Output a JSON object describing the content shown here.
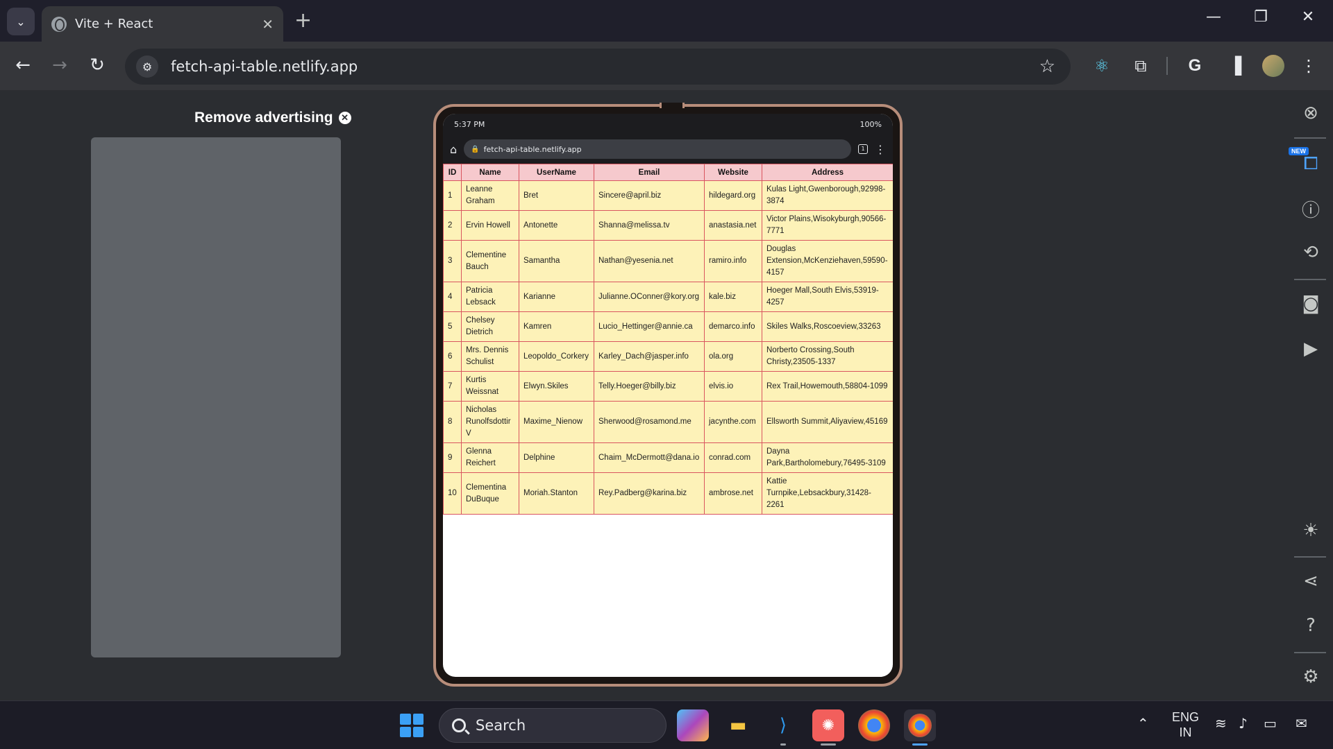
{
  "browser": {
    "tab_title": "Vite + React",
    "url": "fetch-api-table.netlify.app",
    "new_tab": "+",
    "close_tab": "✕"
  },
  "sidebar_ad": {
    "remove_label": "Remove advertising"
  },
  "device": {
    "status_time": "5:37 PM",
    "status_battery": "100%",
    "mobile_url": "fetch-api-table.netlify.app",
    "tab_count": "1"
  },
  "table": {
    "headers": [
      "ID",
      "Name",
      "UserName",
      "Email",
      "Website",
      "Address"
    ],
    "rows": [
      {
        "id": "1",
        "name": "Leanne Graham",
        "username": "Bret",
        "email": "Sincere@april.biz",
        "website": "hildegard.org",
        "address": "Kulas Light,Gwenborough,92998-3874"
      },
      {
        "id": "2",
        "name": "Ervin Howell",
        "username": "Antonette",
        "email": "Shanna@melissa.tv",
        "website": "anastasia.net",
        "address": "Victor Plains,Wisokyburgh,90566-7771"
      },
      {
        "id": "3",
        "name": "Clementine Bauch",
        "username": "Samantha",
        "email": "Nathan@yesenia.net",
        "website": "ramiro.info",
        "address": "Douglas Extension,McKenziehaven,59590-4157"
      },
      {
        "id": "4",
        "name": "Patricia Lebsack",
        "username": "Karianne",
        "email": "Julianne.OConner@kory.org",
        "website": "kale.biz",
        "address": "Hoeger Mall,South Elvis,53919-4257"
      },
      {
        "id": "5",
        "name": "Chelsey Dietrich",
        "username": "Kamren",
        "email": "Lucio_Hettinger@annie.ca",
        "website": "demarco.info",
        "address": "Skiles Walks,Roscoeview,33263"
      },
      {
        "id": "6",
        "name": "Mrs. Dennis Schulist",
        "username": "Leopoldo_Corkery",
        "email": "Karley_Dach@jasper.info",
        "website": "ola.org",
        "address": "Norberto Crossing,South Christy,23505-1337"
      },
      {
        "id": "7",
        "name": "Kurtis Weissnat",
        "username": "Elwyn.Skiles",
        "email": "Telly.Hoeger@billy.biz",
        "website": "elvis.io",
        "address": "Rex Trail,Howemouth,58804-1099"
      },
      {
        "id": "8",
        "name": "Nicholas Runolfsdottir V",
        "username": "Maxime_Nienow",
        "email": "Sherwood@rosamond.me",
        "website": "jacynthe.com",
        "address": "Ellsworth Summit,Aliyaview,45169"
      },
      {
        "id": "9",
        "name": "Glenna Reichert",
        "username": "Delphine",
        "email": "Chaim_McDermott@dana.io",
        "website": "conrad.com",
        "address": "Dayna Park,Bartholomebury,76495-3109"
      },
      {
        "id": "10",
        "name": "Clementina DuBuque",
        "username": "Moriah.Stanton",
        "email": "Rey.Padberg@karina.biz",
        "website": "ambrose.net",
        "address": "Kattie Turnpike,Lebsackbury,31428-2261"
      }
    ]
  },
  "side_panel": {
    "new_badge": "NEW"
  },
  "taskbar": {
    "search_label": "Search",
    "lang_line1": "ENG",
    "lang_line2": "IN"
  },
  "colors": {
    "header_bg": "#f6c9cd",
    "cell_bg": "#fdf2b8",
    "border": "#d9555f",
    "device_frame": "#b78d7a"
  }
}
